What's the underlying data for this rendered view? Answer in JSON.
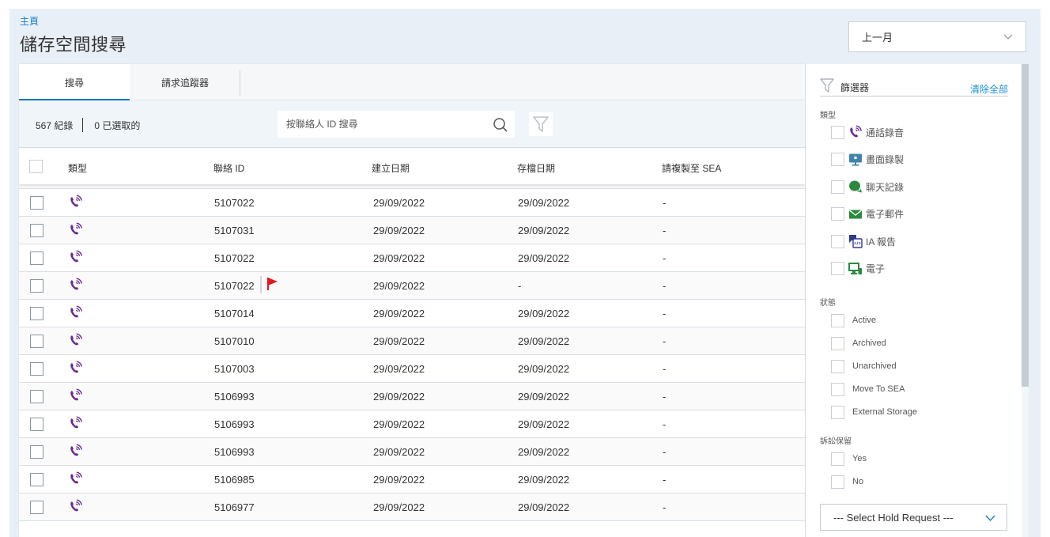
{
  "header": {
    "breadcrumb": "主頁",
    "title": "儲存空間搜尋",
    "period_select": "上一月"
  },
  "tabs": [
    {
      "label": "搜尋",
      "active": true
    },
    {
      "label": "請求追蹤器",
      "active": false
    }
  ],
  "toolbar": {
    "records_count": "567 紀錄",
    "selected_count": "0 已選取的",
    "search_placeholder": "按聯絡人 ID 搜尋",
    "search_value": ""
  },
  "table": {
    "columns": [
      "類型",
      "聯絡 ID",
      "建立日期",
      "存檔日期",
      "請複製至 SEA"
    ],
    "rows": [
      {
        "type": "voice-recording",
        "contact_id": "5107022",
        "created": "29/09/2022",
        "archived": "29/09/2022",
        "copy_to_sea": "-",
        "flag": false
      },
      {
        "type": "voice-recording",
        "contact_id": "5107031",
        "created": "29/09/2022",
        "archived": "29/09/2022",
        "copy_to_sea": "-",
        "flag": false
      },
      {
        "type": "voice-recording",
        "contact_id": "5107022",
        "created": "29/09/2022",
        "archived": "29/09/2022",
        "copy_to_sea": "-",
        "flag": false
      },
      {
        "type": "voice-recording",
        "contact_id": "5107022",
        "created": "29/09/2022",
        "archived": "-",
        "copy_to_sea": "-",
        "flag": true
      },
      {
        "type": "voice-recording",
        "contact_id": "5107014",
        "created": "29/09/2022",
        "archived": "29/09/2022",
        "copy_to_sea": "-",
        "flag": false
      },
      {
        "type": "voice-recording",
        "contact_id": "5107010",
        "created": "29/09/2022",
        "archived": "29/09/2022",
        "copy_to_sea": "-",
        "flag": false
      },
      {
        "type": "voice-recording",
        "contact_id": "5107003",
        "created": "29/09/2022",
        "archived": "29/09/2022",
        "copy_to_sea": "-",
        "flag": false
      },
      {
        "type": "voice-recording",
        "contact_id": "5106993",
        "created": "29/09/2022",
        "archived": "29/09/2022",
        "copy_to_sea": "-",
        "flag": false
      },
      {
        "type": "voice-recording",
        "contact_id": "5106993",
        "created": "29/09/2022",
        "archived": "29/09/2022",
        "copy_to_sea": "-",
        "flag": false
      },
      {
        "type": "voice-recording",
        "contact_id": "5106993",
        "created": "29/09/2022",
        "archived": "29/09/2022",
        "copy_to_sea": "-",
        "flag": false
      },
      {
        "type": "voice-recording",
        "contact_id": "5106985",
        "created": "29/09/2022",
        "archived": "29/09/2022",
        "copy_to_sea": "-",
        "flag": false
      },
      {
        "type": "voice-recording",
        "contact_id": "5106977",
        "created": "29/09/2022",
        "archived": "29/09/2022",
        "copy_to_sea": "-",
        "flag": false
      }
    ]
  },
  "filters": {
    "title": "篩選器",
    "clear_all": "清除全部",
    "type_label": "類型",
    "types": [
      {
        "label": "通話錄音",
        "icon": "voice-recording-icon",
        "color": "#6b2d8f",
        "checked": false
      },
      {
        "label": "畫面錄製",
        "icon": "screen-recording-icon",
        "color": "#3f84ad",
        "checked": false
      },
      {
        "label": "聊天記錄",
        "icon": "chat-icon",
        "color": "#2b8a3e",
        "checked": false
      },
      {
        "label": "電子郵件",
        "icon": "email-icon",
        "color": "#2b8a3e",
        "checked": false
      },
      {
        "label": "IA 報告",
        "icon": "ia-report-icon",
        "color": "#2e3a8c",
        "checked": false
      },
      {
        "label": "電子",
        "icon": "digital-icon",
        "color": "#2b8a3e",
        "checked": false
      }
    ],
    "status_label": "狀態",
    "statuses": [
      {
        "label": "Active",
        "checked": false
      },
      {
        "label": "Archived",
        "checked": false
      },
      {
        "label": "Unarchived",
        "checked": false
      },
      {
        "label": "Move To SEA",
        "checked": false
      },
      {
        "label": "External Storage",
        "checked": false
      }
    ],
    "hold_label": "訴訟保留",
    "holds": [
      {
        "label": "Yes",
        "checked": false
      },
      {
        "label": "No",
        "checked": false
      }
    ],
    "hold_request_select": "--- Select Hold Request ---"
  },
  "colors": {
    "accent": "#0b76b8",
    "link": "#1a8fd6",
    "voice_icon": "#6b2d8f",
    "flag": "#e8141b"
  }
}
